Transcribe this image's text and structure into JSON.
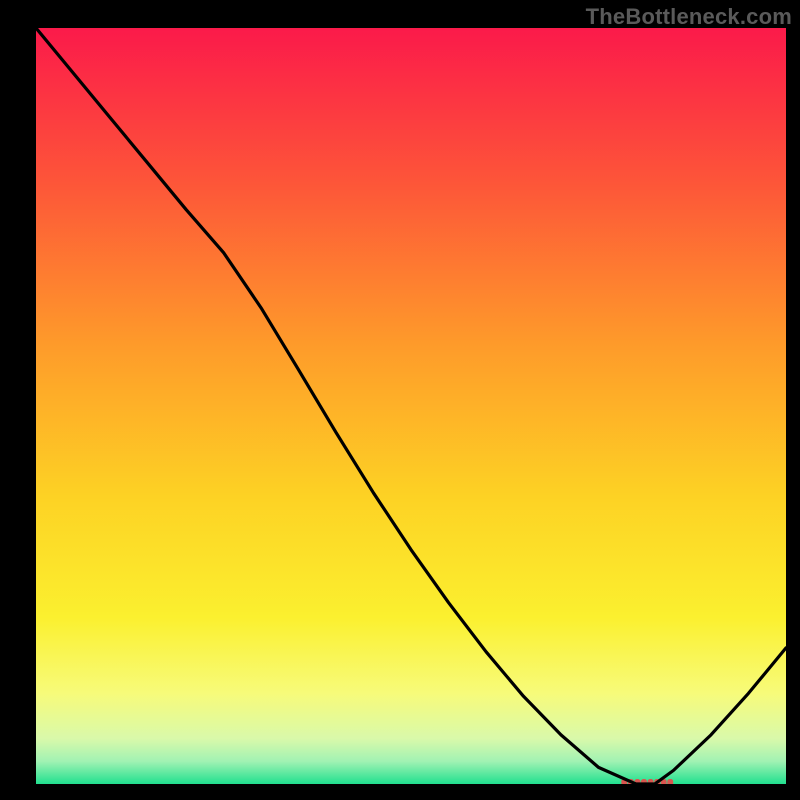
{
  "attribution": "TheBottleneck.com",
  "chart_data": {
    "type": "line",
    "title": "",
    "xlabel": "",
    "ylabel": "",
    "x": [
      0.0,
      0.05,
      0.1,
      0.15,
      0.2,
      0.25,
      0.3,
      0.35,
      0.4,
      0.45,
      0.5,
      0.55,
      0.6,
      0.65,
      0.7,
      0.75,
      0.8,
      0.825,
      0.85,
      0.9,
      0.95,
      1.0
    ],
    "values": [
      1.0,
      0.94,
      0.88,
      0.82,
      0.76,
      0.703,
      0.63,
      0.548,
      0.465,
      0.385,
      0.31,
      0.24,
      0.175,
      0.116,
      0.065,
      0.022,
      0.0,
      0.0,
      0.018,
      0.065,
      0.12,
      0.18
    ],
    "minimum_marker_x_range": [
      0.78,
      0.85
    ],
    "minimum_marker_y": 0.0,
    "xlim": [
      0,
      1
    ],
    "ylim": [
      0,
      1
    ],
    "background_gradient": {
      "stops": [
        {
          "offset": 0.0,
          "color": "#fb1a4a"
        },
        {
          "offset": 0.2,
          "color": "#fd5439"
        },
        {
          "offset": 0.42,
          "color": "#fe9b2a"
        },
        {
          "offset": 0.62,
          "color": "#fdd224"
        },
        {
          "offset": 0.78,
          "color": "#fbf02f"
        },
        {
          "offset": 0.88,
          "color": "#f7fb7a"
        },
        {
          "offset": 0.94,
          "color": "#d9f9aa"
        },
        {
          "offset": 0.97,
          "color": "#a1f2b3"
        },
        {
          "offset": 1.0,
          "color": "#21e08f"
        }
      ]
    }
  }
}
